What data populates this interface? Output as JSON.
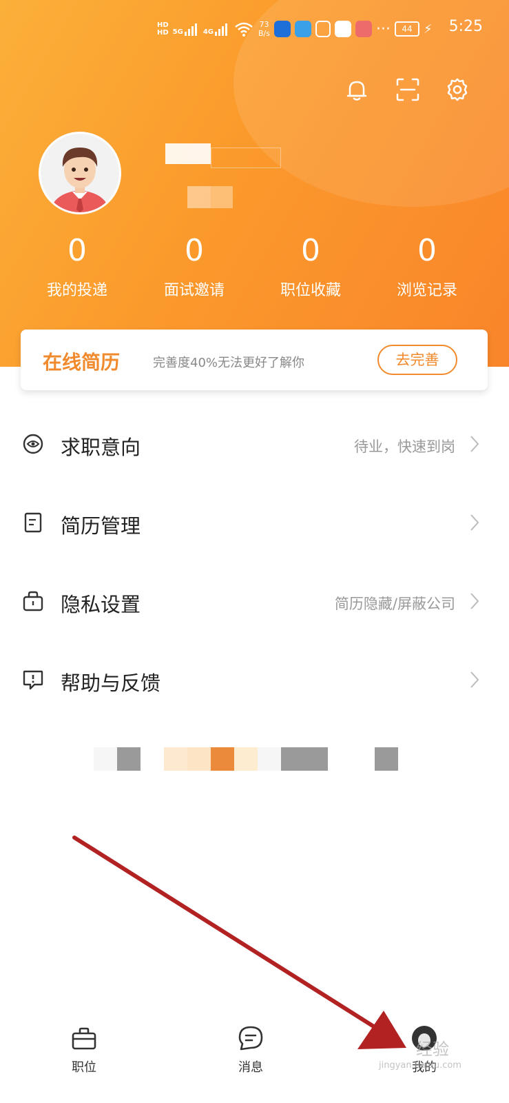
{
  "status_bar": {
    "hd_top": "HD",
    "hd_bottom": "HD",
    "net_5g": "5G",
    "net_4g": "4G",
    "speed_value": "73",
    "speed_unit": "B/s",
    "dots": "···",
    "battery": "44",
    "time": "5:25"
  },
  "header_icons": [
    "bell-icon",
    "scan-icon",
    "settings-icon"
  ],
  "stats": [
    {
      "value": "0",
      "label": "我的投递"
    },
    {
      "value": "0",
      "label": "面试邀请"
    },
    {
      "value": "0",
      "label": "职位收藏"
    },
    {
      "value": "0",
      "label": "浏览记录"
    }
  ],
  "resume_card": {
    "title": "在线简历",
    "desc": "完善度40%无法更好了解你",
    "button": "去完善"
  },
  "menu": [
    {
      "label": "求职意向",
      "sub": "待业，快速到岗",
      "icon": "target-icon"
    },
    {
      "label": "简历管理",
      "sub": "",
      "icon": "document-icon"
    },
    {
      "label": "隐私设置",
      "sub": "简历隐藏/屏蔽公司",
      "icon": "lock-icon"
    },
    {
      "label": "帮助与反馈",
      "sub": "",
      "icon": "help-chat-icon"
    }
  ],
  "tabs": [
    {
      "label": "职位",
      "icon": "briefcase-icon"
    },
    {
      "label": "消息",
      "icon": "message-icon"
    },
    {
      "label": "我的",
      "icon": "avatar-icon"
    }
  ],
  "watermark": {
    "text": "经验",
    "url": "jingyan.baidu.com"
  },
  "colors": {
    "brand_orange": "#f08a2c",
    "header_start": "#fbb03a",
    "header_end": "#f9852a",
    "annotation_arrow": "#b22222"
  }
}
